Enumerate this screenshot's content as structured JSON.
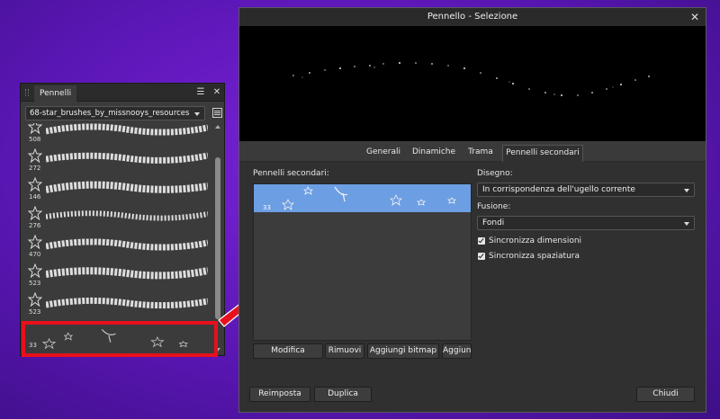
{
  "colors": {
    "accent_selection": "#6c9ee3",
    "highlight_red": "#e8101c",
    "desktop": "#5a16b4"
  },
  "brush_panel": {
    "tab_label": "Pennelli",
    "menu_icon": "hamburger-icon",
    "close_icon": "close-icon",
    "category": "68-star_brushes_by_missnooys_resources",
    "brushes": [
      {
        "size": "508"
      },
      {
        "size": "272"
      },
      {
        "size": "146"
      },
      {
        "size": "276"
      },
      {
        "size": "470"
      },
      {
        "size": "523"
      },
      {
        "size": "523"
      },
      {
        "size": "33"
      }
    ]
  },
  "dialog": {
    "title": "Pennello - Selezione",
    "tabs": [
      {
        "label": "Generali"
      },
      {
        "label": "Dinamiche"
      },
      {
        "label": "Trama"
      },
      {
        "label": "Pennelli secondari",
        "active": true
      }
    ],
    "sub_brushes_label": "Pennelli secondari:",
    "sub_brush_size": "33",
    "buttons": {
      "modifica": "Modifica",
      "rimuovi": "Rimuovi",
      "aggiungi_bitmap": "Aggiungi bitmap",
      "aggiungi": "Aggiun",
      "reimposta": "Reimposta",
      "duplica": "Duplica",
      "chiudi": "Chiudi"
    },
    "disegno_label": "Disegno:",
    "disegno_value": "In corrispondenza dell'ugello corrente",
    "fusione_label": "Fusione:",
    "fusione_value": "Fondi",
    "checkboxes": [
      {
        "label": "Sincronizza dimensioni",
        "checked": true
      },
      {
        "label": "Sincronizza spaziatura",
        "checked": true
      }
    ]
  }
}
